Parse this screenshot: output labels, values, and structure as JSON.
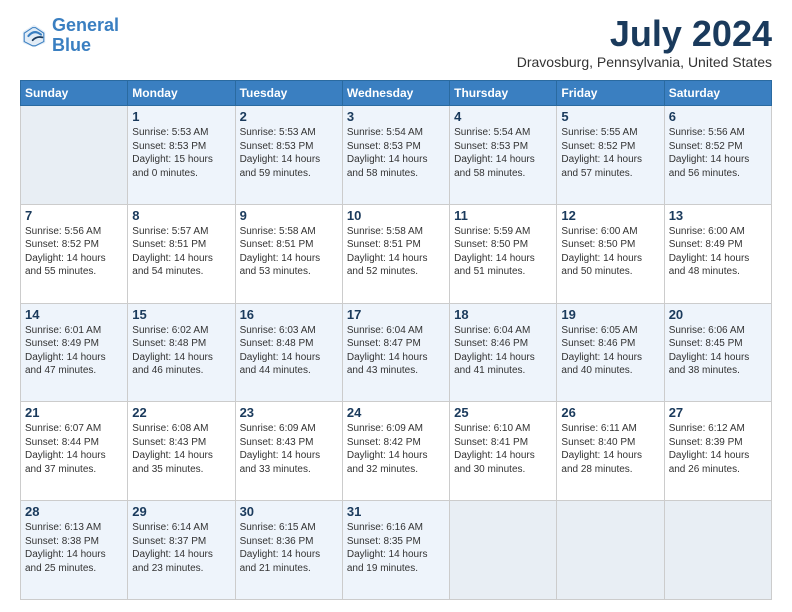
{
  "logo": {
    "line1": "General",
    "line2": "Blue"
  },
  "title": "July 2024",
  "location": "Dravosburg, Pennsylvania, United States",
  "days_of_week": [
    "Sunday",
    "Monday",
    "Tuesday",
    "Wednesday",
    "Thursday",
    "Friday",
    "Saturday"
  ],
  "weeks": [
    [
      {
        "day": "",
        "empty": true
      },
      {
        "day": "1",
        "sunrise": "5:53 AM",
        "sunset": "8:53 PM",
        "daylight": "15 hours and 0 minutes."
      },
      {
        "day": "2",
        "sunrise": "5:53 AM",
        "sunset": "8:53 PM",
        "daylight": "14 hours and 59 minutes."
      },
      {
        "day": "3",
        "sunrise": "5:54 AM",
        "sunset": "8:53 PM",
        "daylight": "14 hours and 58 minutes."
      },
      {
        "day": "4",
        "sunrise": "5:54 AM",
        "sunset": "8:53 PM",
        "daylight": "14 hours and 58 minutes."
      },
      {
        "day": "5",
        "sunrise": "5:55 AM",
        "sunset": "8:52 PM",
        "daylight": "14 hours and 57 minutes."
      },
      {
        "day": "6",
        "sunrise": "5:56 AM",
        "sunset": "8:52 PM",
        "daylight": "14 hours and 56 minutes."
      }
    ],
    [
      {
        "day": "7",
        "sunrise": "5:56 AM",
        "sunset": "8:52 PM",
        "daylight": "14 hours and 55 minutes."
      },
      {
        "day": "8",
        "sunrise": "5:57 AM",
        "sunset": "8:51 PM",
        "daylight": "14 hours and 54 minutes."
      },
      {
        "day": "9",
        "sunrise": "5:58 AM",
        "sunset": "8:51 PM",
        "daylight": "14 hours and 53 minutes."
      },
      {
        "day": "10",
        "sunrise": "5:58 AM",
        "sunset": "8:51 PM",
        "daylight": "14 hours and 52 minutes."
      },
      {
        "day": "11",
        "sunrise": "5:59 AM",
        "sunset": "8:50 PM",
        "daylight": "14 hours and 51 minutes."
      },
      {
        "day": "12",
        "sunrise": "6:00 AM",
        "sunset": "8:50 PM",
        "daylight": "14 hours and 50 minutes."
      },
      {
        "day": "13",
        "sunrise": "6:00 AM",
        "sunset": "8:49 PM",
        "daylight": "14 hours and 48 minutes."
      }
    ],
    [
      {
        "day": "14",
        "sunrise": "6:01 AM",
        "sunset": "8:49 PM",
        "daylight": "14 hours and 47 minutes."
      },
      {
        "day": "15",
        "sunrise": "6:02 AM",
        "sunset": "8:48 PM",
        "daylight": "14 hours and 46 minutes."
      },
      {
        "day": "16",
        "sunrise": "6:03 AM",
        "sunset": "8:48 PM",
        "daylight": "14 hours and 44 minutes."
      },
      {
        "day": "17",
        "sunrise": "6:04 AM",
        "sunset": "8:47 PM",
        "daylight": "14 hours and 43 minutes."
      },
      {
        "day": "18",
        "sunrise": "6:04 AM",
        "sunset": "8:46 PM",
        "daylight": "14 hours and 41 minutes."
      },
      {
        "day": "19",
        "sunrise": "6:05 AM",
        "sunset": "8:46 PM",
        "daylight": "14 hours and 40 minutes."
      },
      {
        "day": "20",
        "sunrise": "6:06 AM",
        "sunset": "8:45 PM",
        "daylight": "14 hours and 38 minutes."
      }
    ],
    [
      {
        "day": "21",
        "sunrise": "6:07 AM",
        "sunset": "8:44 PM",
        "daylight": "14 hours and 37 minutes."
      },
      {
        "day": "22",
        "sunrise": "6:08 AM",
        "sunset": "8:43 PM",
        "daylight": "14 hours and 35 minutes."
      },
      {
        "day": "23",
        "sunrise": "6:09 AM",
        "sunset": "8:43 PM",
        "daylight": "14 hours and 33 minutes."
      },
      {
        "day": "24",
        "sunrise": "6:09 AM",
        "sunset": "8:42 PM",
        "daylight": "14 hours and 32 minutes."
      },
      {
        "day": "25",
        "sunrise": "6:10 AM",
        "sunset": "8:41 PM",
        "daylight": "14 hours and 30 minutes."
      },
      {
        "day": "26",
        "sunrise": "6:11 AM",
        "sunset": "8:40 PM",
        "daylight": "14 hours and 28 minutes."
      },
      {
        "day": "27",
        "sunrise": "6:12 AM",
        "sunset": "8:39 PM",
        "daylight": "14 hours and 26 minutes."
      }
    ],
    [
      {
        "day": "28",
        "sunrise": "6:13 AM",
        "sunset": "8:38 PM",
        "daylight": "14 hours and 25 minutes."
      },
      {
        "day": "29",
        "sunrise": "6:14 AM",
        "sunset": "8:37 PM",
        "daylight": "14 hours and 23 minutes."
      },
      {
        "day": "30",
        "sunrise": "6:15 AM",
        "sunset": "8:36 PM",
        "daylight": "14 hours and 21 minutes."
      },
      {
        "day": "31",
        "sunrise": "6:16 AM",
        "sunset": "8:35 PM",
        "daylight": "14 hours and 19 minutes."
      },
      {
        "day": "",
        "empty": true
      },
      {
        "day": "",
        "empty": true
      },
      {
        "day": "",
        "empty": true
      }
    ]
  ]
}
